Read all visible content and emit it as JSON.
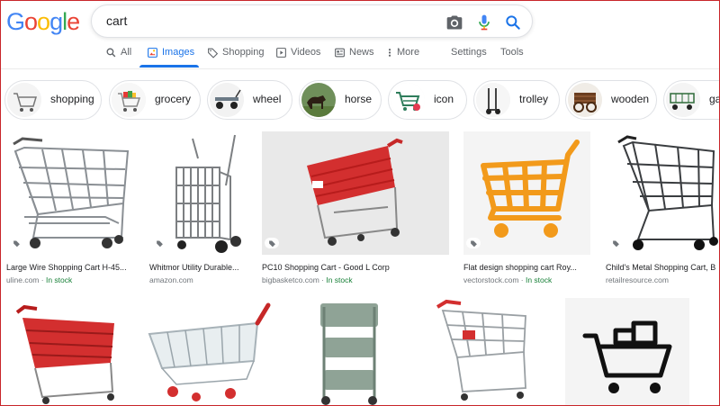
{
  "logo": {
    "letters": [
      "G",
      "o",
      "o",
      "g",
      "l",
      "e"
    ],
    "colors": [
      "#4285F4",
      "#EA4335",
      "#FBBC05",
      "#4285F4",
      "#34A853",
      "#EA4335"
    ]
  },
  "search": {
    "query": "cart",
    "icons": [
      "camera-icon",
      "mic-icon",
      "search-icon"
    ]
  },
  "tabs": [
    {
      "label": "All",
      "icon": "search-icon"
    },
    {
      "label": "Images",
      "icon": "image-icon",
      "active": true
    },
    {
      "label": "Shopping",
      "icon": "tag-icon"
    },
    {
      "label": "Videos",
      "icon": "play-icon"
    },
    {
      "label": "News",
      "icon": "news-icon"
    },
    {
      "label": "More",
      "icon": "more-vert-icon"
    },
    {
      "label": "Settings"
    },
    {
      "label": "Tools"
    }
  ],
  "chips": [
    {
      "label": "shopping"
    },
    {
      "label": "grocery"
    },
    {
      "label": "wheel"
    },
    {
      "label": "horse"
    },
    {
      "label": "icon"
    },
    {
      "label": "trolley"
    },
    {
      "label": "wooden"
    },
    {
      "label": "ga"
    }
  ],
  "results": [
    {
      "title": "Large Wire Shopping Cart H-45...",
      "source": "uline.com",
      "stock": "In stock"
    },
    {
      "title": "Whitmor Utility Durable...",
      "source": "amazon.com",
      "stock": ""
    },
    {
      "title": "PC10 Shopping Cart - Good L Corp",
      "source": "bigbasketco.com",
      "stock": "In stock"
    },
    {
      "title": "Flat design shopping cart Roy...",
      "source": "vectorstock.com",
      "stock": "In stock"
    },
    {
      "title": "Child's Metal Shopping Cart, B",
      "source": "retailresource.com",
      "stock": ""
    }
  ],
  "colors": {
    "accent": "#1a73e8",
    "in_stock": "#188038",
    "cart_red": "#d93025",
    "cart_orange": "#f29a1b",
    "cart_green": "#8fa396"
  }
}
